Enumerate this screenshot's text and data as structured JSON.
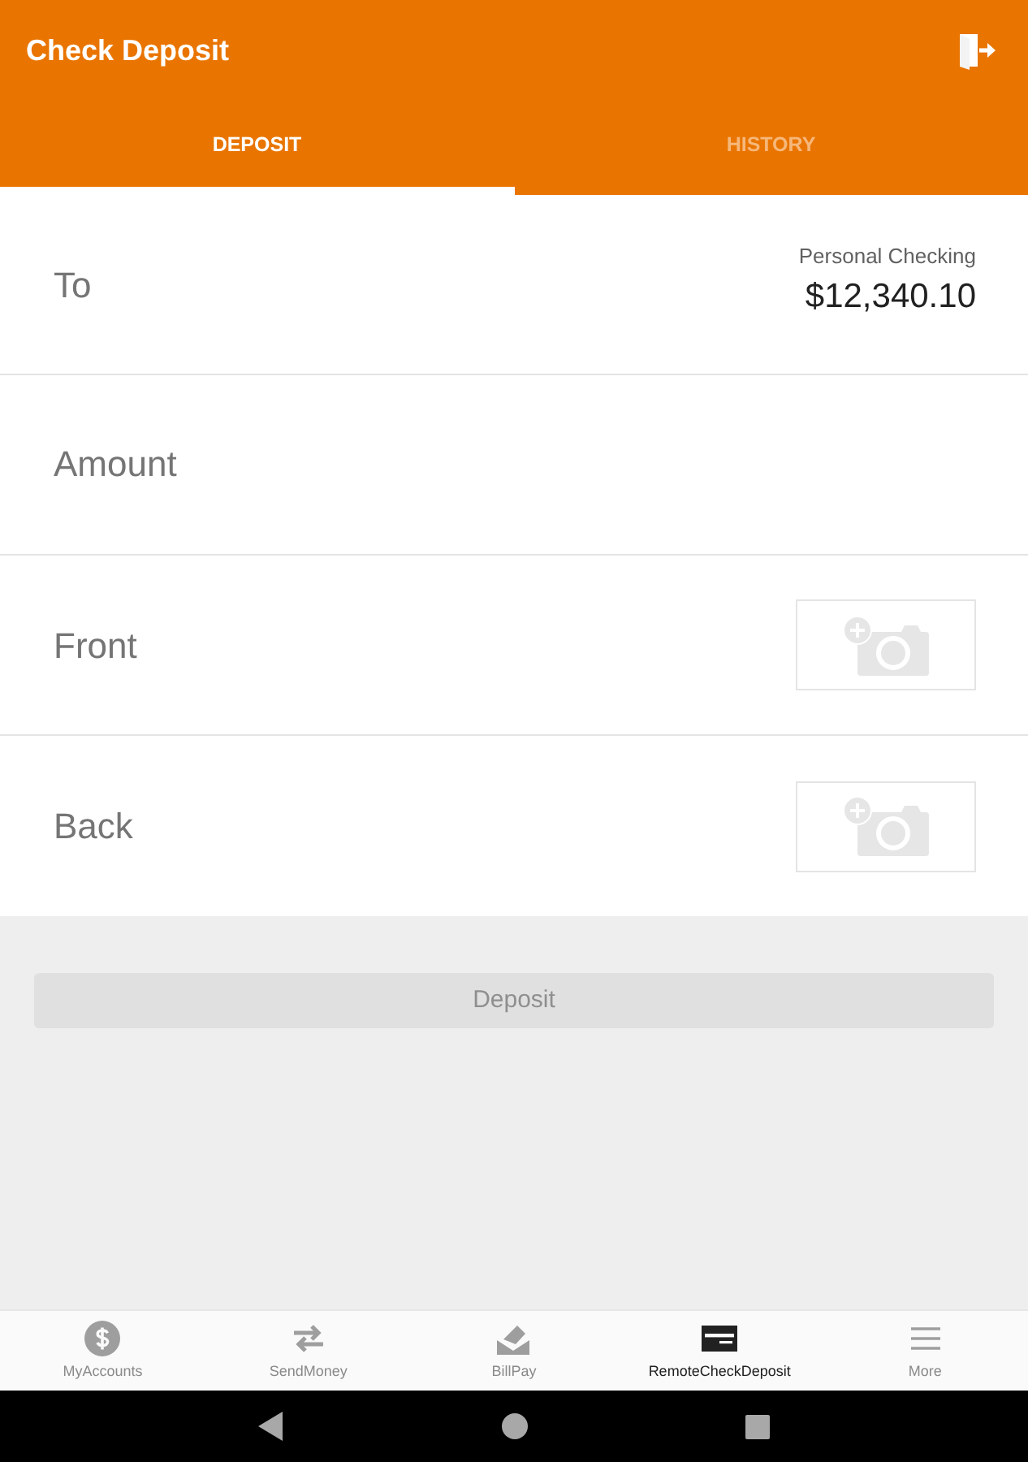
{
  "header": {
    "title": "Check Deposit"
  },
  "tabs": [
    {
      "label": "DEPOSIT",
      "selected": true
    },
    {
      "label": "HISTORY",
      "selected": false
    }
  ],
  "form_rows": [
    {
      "kind": "account",
      "label": "To",
      "account_name": "Personal Checking",
      "balance": "$12,340.10"
    },
    {
      "kind": "input",
      "placeholder": "Amount"
    },
    {
      "kind": "photo",
      "label": "Front"
    },
    {
      "kind": "photo",
      "label": "Back"
    }
  ],
  "deposit_button": {
    "label": "Deposit",
    "disabled": true
  },
  "bottom_nav": [
    {
      "kind": "accounts",
      "label": "MyAccounts",
      "selected": false
    },
    {
      "kind": "transfer",
      "label": "SendMoney",
      "selected": false
    },
    {
      "kind": "billpay",
      "label": "BillPay",
      "selected": false
    },
    {
      "kind": "check",
      "label": "RemoteCheckDeposit",
      "selected": true
    },
    {
      "kind": "more",
      "label": "More",
      "selected": false
    }
  ]
}
